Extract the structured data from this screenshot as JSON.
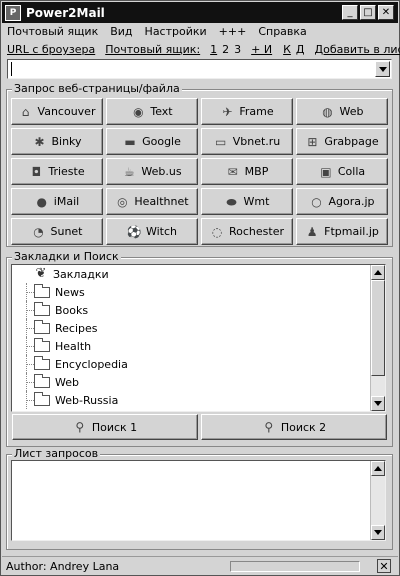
{
  "window": {
    "title": "Power2Mail"
  },
  "menu": [
    {
      "label": "Почтовый ящик"
    },
    {
      "label": "Вид"
    },
    {
      "label": "Настройки"
    },
    {
      "label": "+++"
    },
    {
      "label": "Справка"
    }
  ],
  "links": {
    "url_from_browser": "URL с броузера",
    "mailbox_label": "Почтовый ящик:",
    "mb1": "1",
    "mb2": "2",
    "mb3": "3",
    "plus_i": "+ И",
    "k": "К",
    "d": "Д",
    "add_to_list": "Добавить в лист"
  },
  "url_input": {
    "value": ""
  },
  "web_group": {
    "title": "Запрос веб-страницы/файла",
    "buttons": [
      {
        "label": "Vancouver",
        "icon": "house-icon",
        "glyph": "⌂"
      },
      {
        "label": "Text",
        "icon": "eye-icon",
        "glyph": "◉"
      },
      {
        "label": "Frame",
        "icon": "paper-plane-icon",
        "glyph": "✈"
      },
      {
        "label": "Web",
        "icon": "globe-icon",
        "glyph": "◍"
      },
      {
        "label": "Binky",
        "icon": "gear-icon",
        "glyph": "✱"
      },
      {
        "label": "Google",
        "icon": "car-icon",
        "glyph": "▬"
      },
      {
        "label": "Vbnet.ru",
        "icon": "monitor-icon",
        "glyph": "▭"
      },
      {
        "label": "Grabpage",
        "icon": "cart-icon",
        "glyph": "⊞"
      },
      {
        "label": "Trieste",
        "icon": "image-icon",
        "glyph": "◘"
      },
      {
        "label": "Web.us",
        "icon": "cup-icon",
        "glyph": "☕"
      },
      {
        "label": "MBP",
        "icon": "envelope-icon",
        "glyph": "✉"
      },
      {
        "label": "Colla",
        "icon": "disk-icon",
        "glyph": "▣"
      },
      {
        "label": "iMail",
        "icon": "ball-icon",
        "glyph": "●"
      },
      {
        "label": "Healthnet",
        "icon": "globe-icon",
        "glyph": "◎"
      },
      {
        "label": "Wmt",
        "icon": "rugby-ball-icon",
        "glyph": "⬬"
      },
      {
        "label": "Agora.jp",
        "icon": "circle-icon",
        "glyph": "○"
      },
      {
        "label": "Sunet",
        "icon": "fish-icon",
        "glyph": "◔"
      },
      {
        "label": "Witch",
        "icon": "soccer-ball-icon",
        "glyph": "⚽"
      },
      {
        "label": "Rochester",
        "icon": "cd-icon",
        "glyph": "◌"
      },
      {
        "label": "Ftpmail.jp",
        "icon": "penguin-icon",
        "glyph": "♟"
      }
    ]
  },
  "bookmarks_group": {
    "title": "Закладки и Поиск",
    "root": "Закладки",
    "folders": [
      "News",
      "Books",
      "Recipes",
      "Health",
      "Encyclopedia",
      "Web",
      "Web-Russia"
    ],
    "search1": "Поиск 1",
    "search2": "Поиск 2"
  },
  "requests_group": {
    "title": "Лист запросов"
  },
  "status": {
    "text": "Author: Andrey Lana"
  }
}
